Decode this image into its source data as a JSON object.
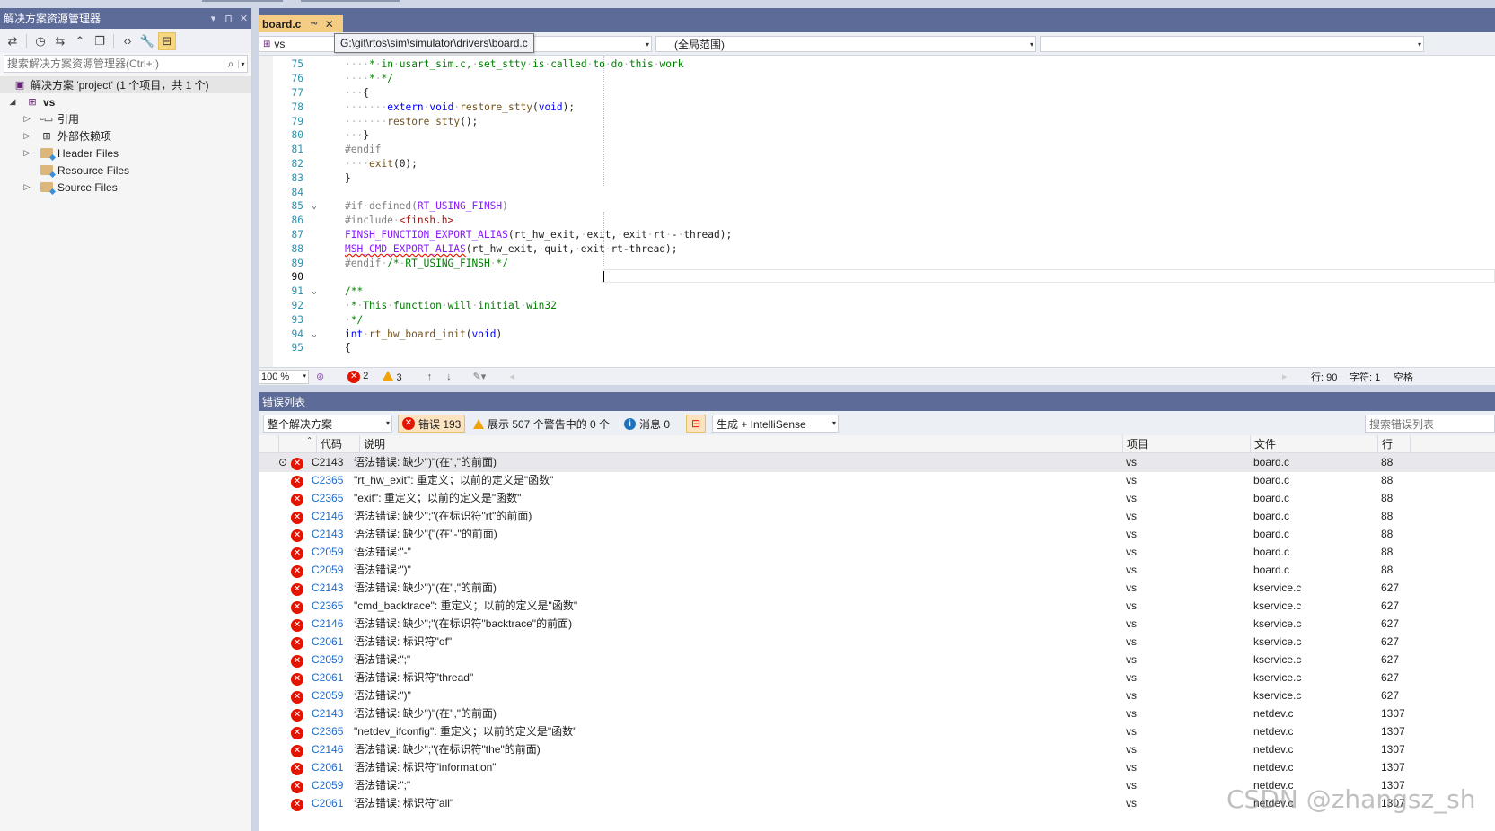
{
  "solution_explorer": {
    "title": "解决方案资源管理器",
    "search_placeholder": "搜索解决方案资源管理器(Ctrl+;)",
    "solution_label": "解决方案 'project' (1 个项目，共 1 个)",
    "project": "vs",
    "nodes": [
      "引用",
      "外部依赖项",
      "Header Files",
      "Resource Files",
      "Source Files"
    ]
  },
  "editor": {
    "tab_label": "board.c",
    "tooltip": "G:\\git\\rtos\\sim\\simulator\\drivers\\board.c",
    "nav_project": "vs",
    "nav_scope": "(全局范围)",
    "zoom": "100 %",
    "errors_count": "2",
    "warnings_count": "3",
    "line_label": "行: 90",
    "char_label": "字符: 1",
    "extra_label": "空格",
    "lines": [
      {
        "n": "75",
        "t": "····*·in·usart_sim.c,·set_stty·is·called·to·do·this·work"
      },
      {
        "n": "76",
        "t": "····*·*/"
      },
      {
        "n": "77",
        "t": "···{"
      },
      {
        "n": "78",
        "t": "·······extern·void·restore_stty(void);"
      },
      {
        "n": "79",
        "t": "·······restore_stty();"
      },
      {
        "n": "80",
        "t": "···}"
      },
      {
        "n": "81",
        "t": "#endif"
      },
      {
        "n": "82",
        "t": "····exit(0);"
      },
      {
        "n": "83",
        "t": "}"
      },
      {
        "n": "84",
        "t": ""
      },
      {
        "n": "85",
        "t": "#if·defined(RT_USING_FINSH)"
      },
      {
        "n": "86",
        "t": "#include·<finsh.h>"
      },
      {
        "n": "87",
        "t": "FINSH_FUNCTION_EXPORT_ALIAS(rt_hw_exit,·exit,·exit·rt·-·thread);"
      },
      {
        "n": "88",
        "t": "MSH_CMD_EXPORT_ALIAS(rt_hw_exit,·quit,·exit·rt-thread);"
      },
      {
        "n": "89",
        "t": "#endif·/*·RT_USING_FINSH·*/"
      },
      {
        "n": "90",
        "t": ""
      },
      {
        "n": "91",
        "t": "/**"
      },
      {
        "n": "92",
        "t": "·*·This·function·will·initial·win32"
      },
      {
        "n": "93",
        "t": "·*/"
      },
      {
        "n": "94",
        "t": "int·rt_hw_board_init(void)"
      },
      {
        "n": "95",
        "t": "{"
      }
    ]
  },
  "error_list": {
    "title": "错误列表",
    "scope": "整个解决方案",
    "errors_btn": "错误 193",
    "warnings_btn": "展示 507 个警告中的 0 个",
    "messages_btn": "消息 0",
    "build_filter": "生成 + IntelliSense",
    "search_placeholder": "搜索错误列表",
    "columns": [
      "代码",
      "说明",
      "项目",
      "文件",
      "行"
    ],
    "rows": [
      {
        "code": "C2143",
        "desc": "语法错误: 缺少\")\"(在\",\"的前面)",
        "project": "vs",
        "file": "board.c",
        "line": "88"
      },
      {
        "code": "C2365",
        "desc": "\"rt_hw_exit\": 重定义；以前的定义是\"函数\"",
        "project": "vs",
        "file": "board.c",
        "line": "88"
      },
      {
        "code": "C2365",
        "desc": "\"exit\": 重定义；以前的定义是\"函数\"",
        "project": "vs",
        "file": "board.c",
        "line": "88"
      },
      {
        "code": "C2146",
        "desc": "语法错误: 缺少\";\"(在标识符\"rt\"的前面)",
        "project": "vs",
        "file": "board.c",
        "line": "88"
      },
      {
        "code": "C2143",
        "desc": "语法错误: 缺少\"{\"(在\"-\"的前面)",
        "project": "vs",
        "file": "board.c",
        "line": "88"
      },
      {
        "code": "C2059",
        "desc": "语法错误:\"-\"",
        "project": "vs",
        "file": "board.c",
        "line": "88"
      },
      {
        "code": "C2059",
        "desc": "语法错误:\")\"",
        "project": "vs",
        "file": "board.c",
        "line": "88"
      },
      {
        "code": "C2143",
        "desc": "语法错误: 缺少\")\"(在\",\"的前面)",
        "project": "vs",
        "file": "kservice.c",
        "line": "627"
      },
      {
        "code": "C2365",
        "desc": "\"cmd_backtrace\": 重定义；以前的定义是\"函数\"",
        "project": "vs",
        "file": "kservice.c",
        "line": "627"
      },
      {
        "code": "C2146",
        "desc": "语法错误: 缺少\";\"(在标识符\"backtrace\"的前面)",
        "project": "vs",
        "file": "kservice.c",
        "line": "627"
      },
      {
        "code": "C2061",
        "desc": "语法错误: 标识符\"of\"",
        "project": "vs",
        "file": "kservice.c",
        "line": "627"
      },
      {
        "code": "C2059",
        "desc": "语法错误:\";\"",
        "project": "vs",
        "file": "kservice.c",
        "line": "627"
      },
      {
        "code": "C2061",
        "desc": "语法错误: 标识符\"thread\"",
        "project": "vs",
        "file": "kservice.c",
        "line": "627"
      },
      {
        "code": "C2059",
        "desc": "语法错误:\")\"",
        "project": "vs",
        "file": "kservice.c",
        "line": "627"
      },
      {
        "code": "C2143",
        "desc": "语法错误: 缺少\")\"(在\",\"的前面)",
        "project": "vs",
        "file": "netdev.c",
        "line": "1307"
      },
      {
        "code": "C2365",
        "desc": "\"netdev_ifconfig\": 重定义；以前的定义是\"函数\"",
        "project": "vs",
        "file": "netdev.c",
        "line": "1307"
      },
      {
        "code": "C2146",
        "desc": "语法错误: 缺少\";\"(在标识符\"the\"的前面)",
        "project": "vs",
        "file": "netdev.c",
        "line": "1307"
      },
      {
        "code": "C2061",
        "desc": "语法错误: 标识符\"information\"",
        "project": "vs",
        "file": "netdev.c",
        "line": "1307"
      },
      {
        "code": "C2059",
        "desc": "语法错误:\";\"",
        "project": "vs",
        "file": "netdev.c",
        "line": "1307"
      },
      {
        "code": "C2061",
        "desc": "语法错误: 标识符\"all\"",
        "project": "vs",
        "file": "netdev.c",
        "line": "1307"
      }
    ]
  },
  "watermark": "CSDN @zhangsz_sh",
  "colors": {
    "titlebar": "#5d6b99",
    "active_tab": "#f5cc84",
    "error": "#e51400",
    "link": "#1e6ac8"
  }
}
